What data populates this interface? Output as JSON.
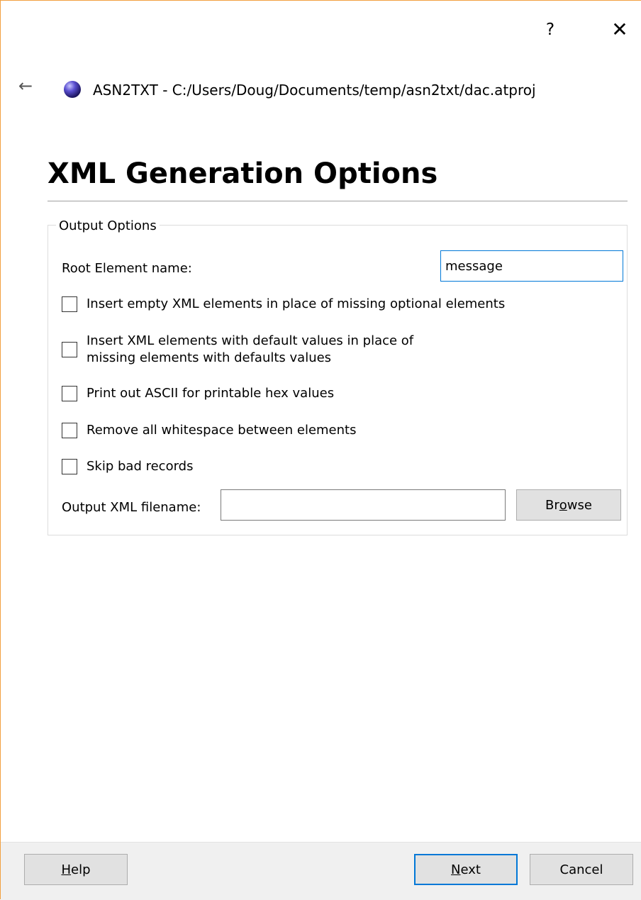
{
  "window": {
    "help_glyph": "?",
    "close_glyph": "✕",
    "back_glyph": "←",
    "title": "ASN2TXT - C:/Users/Doug/Documents/temp/asn2txt/dac.atproj",
    "accent_color": "#0078d7",
    "border_color": "#f2a040"
  },
  "page": {
    "title": "XML Generation Options"
  },
  "output_options": {
    "legend": "Output Options",
    "root_element_label": "Root Element name:",
    "root_element_value": "message",
    "checkboxes": [
      {
        "label": "Insert empty XML elements in place of missing optional elements",
        "checked": false
      },
      {
        "label": "Insert XML elements with default values in place of\n missing elements with defaults values",
        "checked": false
      },
      {
        "label": "Print out ASCII for printable hex values",
        "checked": false
      },
      {
        "label": "Remove all whitespace between elements",
        "checked": false
      },
      {
        "label": "Skip bad records",
        "checked": false
      }
    ],
    "output_file_label": "Output XML filename:",
    "output_file_value": "",
    "browse_pre": "Br",
    "browse_mnemonic": "o",
    "browse_post": "wse"
  },
  "footer": {
    "help_mnemonic": "H",
    "help_rest": "elp",
    "next_mnemonic": "N",
    "next_rest": "ext",
    "cancel_label": "Cancel"
  }
}
